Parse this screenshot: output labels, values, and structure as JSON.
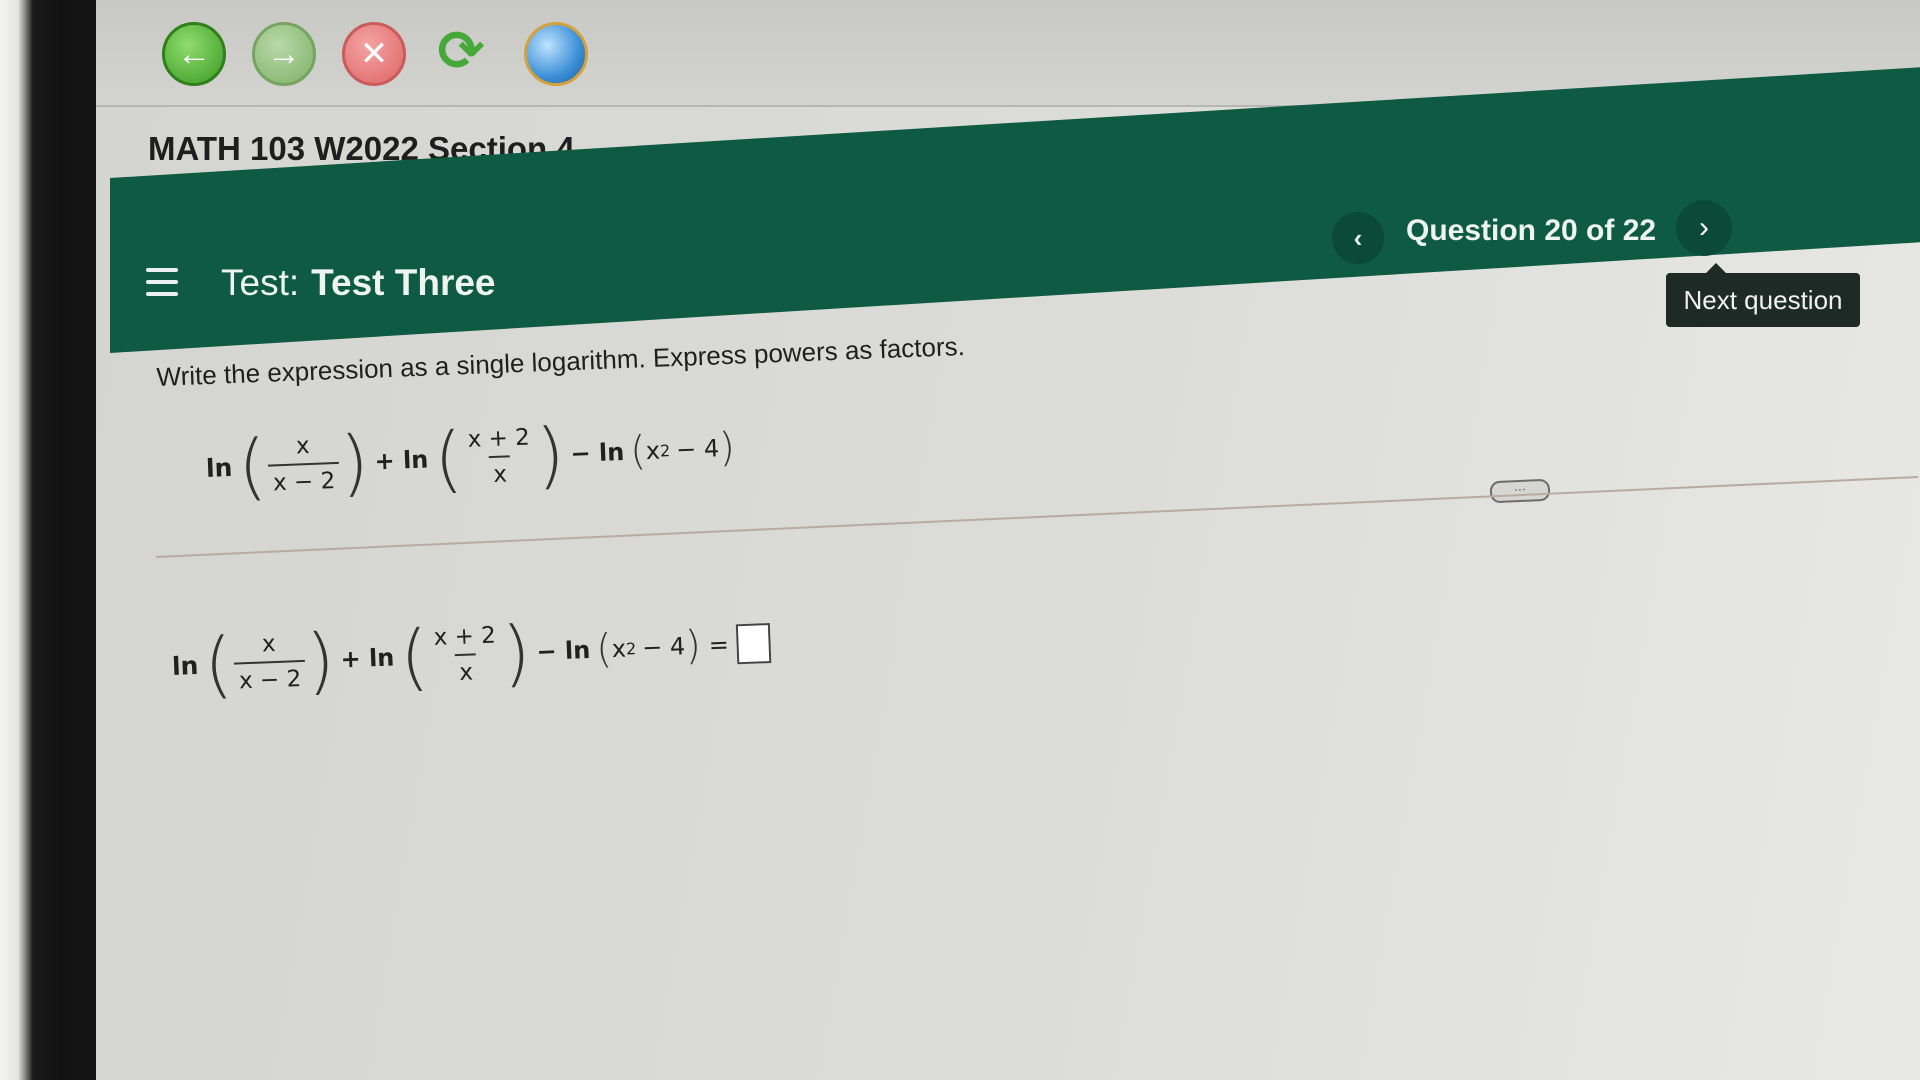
{
  "browser": {
    "back_icon": "back-arrow-icon",
    "forward_icon": "forward-arrow-icon",
    "stop_icon": "stop-x-icon",
    "refresh_icon": "refresh-icon",
    "home_icon": "globe-icon",
    "back_glyph": "←",
    "forward_glyph": "→",
    "stop_glyph": "✕",
    "refresh_glyph": "⟳"
  },
  "course": {
    "title": "MATH 103 W2022 Section 4"
  },
  "header": {
    "menu_icon": "hamburger-menu-icon",
    "test_prefix": "Test:",
    "test_name": "Test Three",
    "question_counter": "Question 20 of 22",
    "prev_glyph": "‹",
    "next_glyph": "›",
    "next_tooltip": "Next question",
    "accent_color": "#0e5a42"
  },
  "question": {
    "instruction": "Write the expression as a single logarithm.  Express powers as factors.",
    "expression": {
      "ln": "ln",
      "frac1_num": "x",
      "frac1_den": "x − 2",
      "plus": "+ ln",
      "frac2_num": "x + 2",
      "frac2_den": "x",
      "minus": "− ln",
      "last_base": "x",
      "last_exp": "2",
      "last_tail": "− 4",
      "equals": "="
    },
    "more_label": "···"
  }
}
